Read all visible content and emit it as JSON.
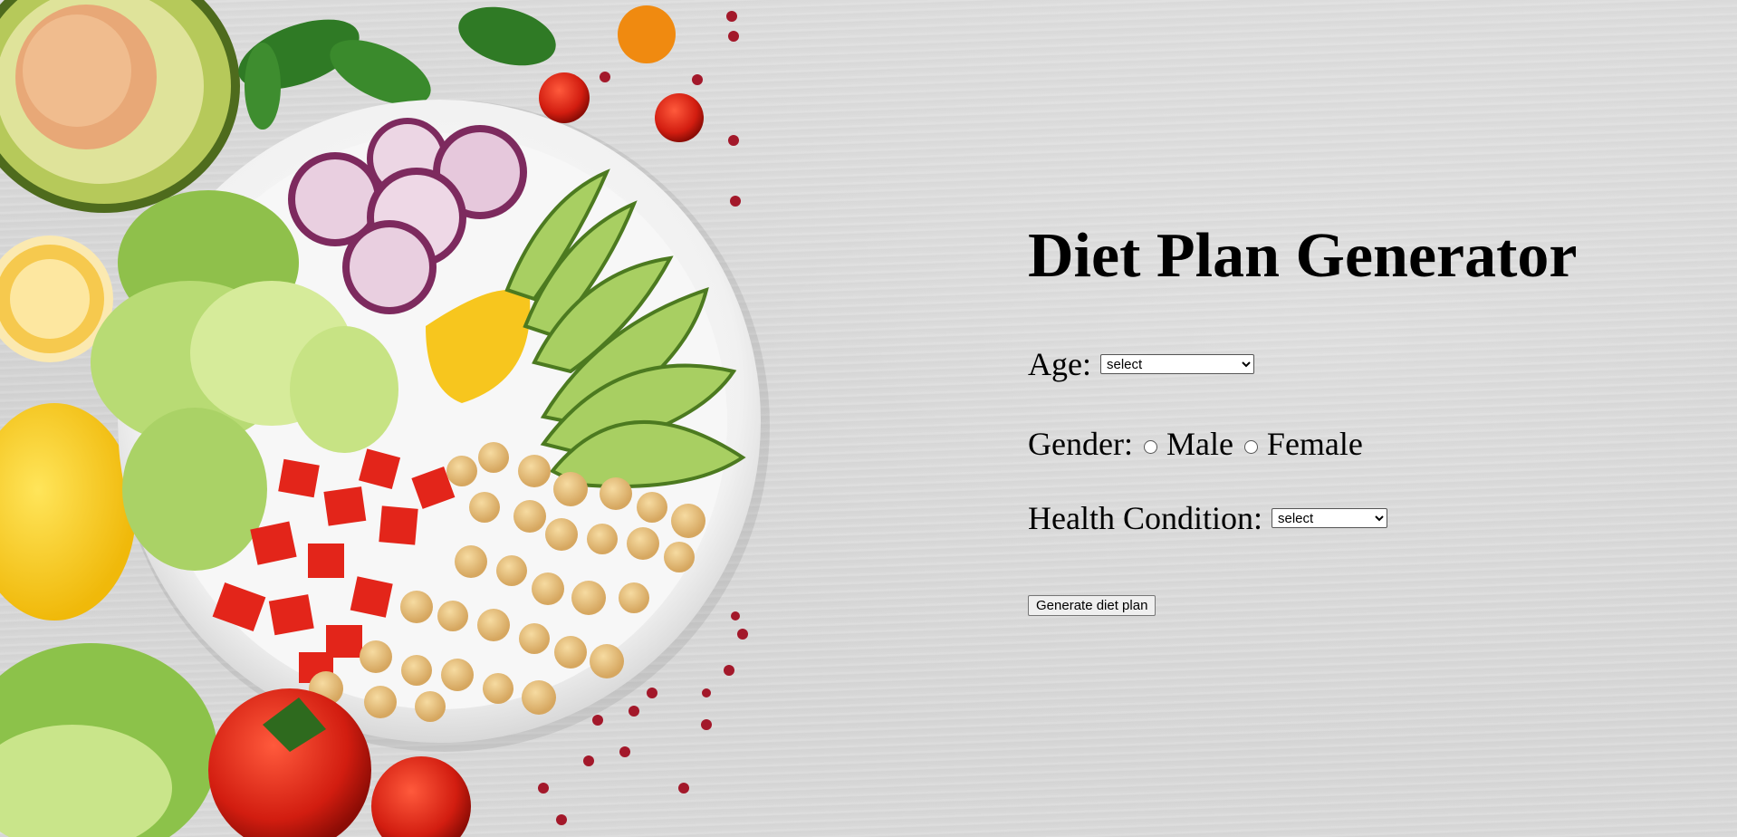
{
  "page": {
    "title": "Diet Plan Generator"
  },
  "form": {
    "age_label": "Age:",
    "age_value": "select",
    "gender_label": "Gender:",
    "gender_options": [
      "Male",
      "Female"
    ],
    "health_label": "Health Condition:",
    "health_value": "select",
    "submit_label": "Generate diet plan"
  },
  "background": {
    "description": "healthy salad bowl with radish, avocado, lettuce, tomato, chickpeas and lemons on grey concrete"
  }
}
